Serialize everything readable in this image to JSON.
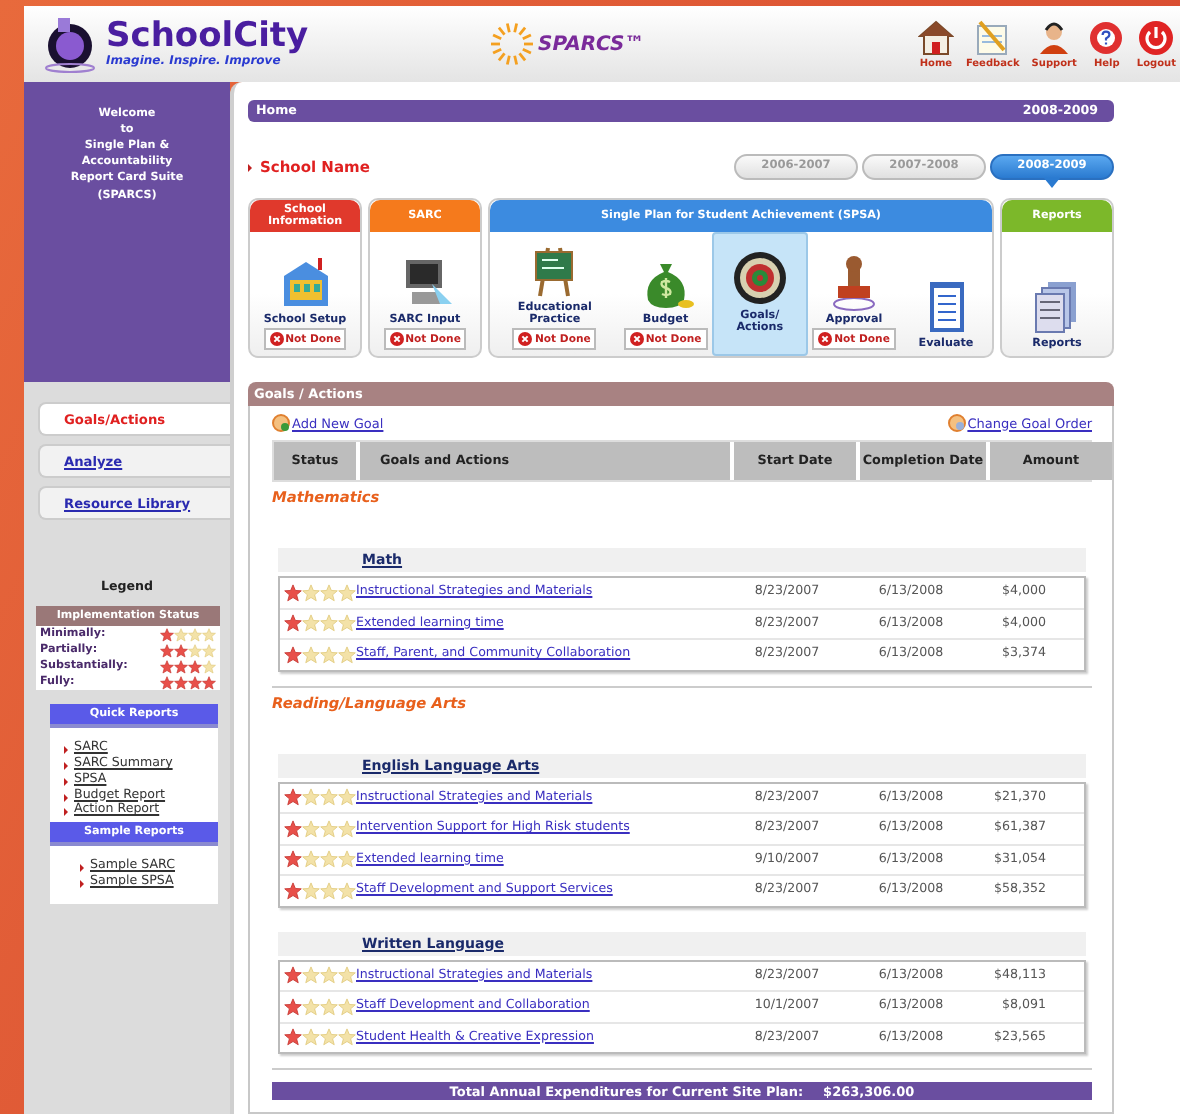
{
  "header": {
    "logo": {
      "name": "SchoolCity",
      "tagline": "Imagine. Inspire. Improve"
    },
    "product": "SPARCS™",
    "links": [
      {
        "label": "Home",
        "kind": "home"
      },
      {
        "label": "Feedback",
        "kind": "feedback"
      },
      {
        "label": "Support",
        "kind": "support"
      },
      {
        "label": "Help",
        "kind": "help"
      },
      {
        "label": "Logout",
        "kind": "logout"
      }
    ]
  },
  "sidebar": {
    "welcome": "Welcome\nto\nSingle Plan &\nAccountability\nReport Card Suite\n(SPARCS)",
    "nav": [
      {
        "label": "Goals/Actions",
        "selected": true
      },
      {
        "label": "Analyze",
        "selected": false
      },
      {
        "label": "Resource Library",
        "selected": false
      }
    ],
    "legend": {
      "title": "Legend",
      "heading": "Implementation Status",
      "levels": [
        {
          "label": "Minimally:",
          "stars": 1
        },
        {
          "label": "Partially:",
          "stars": 2
        },
        {
          "label": "Substantially:",
          "stars": 3
        },
        {
          "label": "Fully:",
          "stars": 4
        }
      ]
    },
    "quick_reports": {
      "title": "Quick Reports",
      "links": [
        "SARC",
        "SARC Summary",
        "SPSA",
        "Budget Report",
        "Action Report"
      ]
    },
    "sample_reports": {
      "title": "Sample Reports",
      "links": [
        "Sample SARC",
        "Sample SPSA"
      ]
    }
  },
  "breadcrumb": {
    "label": "Home",
    "year": "2008-2009"
  },
  "school_name": "School Name",
  "years": [
    {
      "label": "2006-2007",
      "selected": false
    },
    {
      "label": "2007-2008",
      "selected": false
    },
    {
      "label": "2008-2009",
      "selected": true
    }
  ],
  "modules": [
    {
      "title": "School Information",
      "color": "#e0392c",
      "items": [
        {
          "label": "School Setup",
          "kind": "building",
          "status": "Not Done",
          "selected": false
        }
      ]
    },
    {
      "title": "SARC",
      "color": "#f57a1c",
      "items": [
        {
          "label": "SARC Input",
          "kind": "computer",
          "status": "Not Done",
          "selected": false
        }
      ]
    },
    {
      "title": "Single Plan for Student Achievement (SPSA)",
      "color": "#3c8be0",
      "items": [
        {
          "label": "Educational Practice",
          "kind": "easel",
          "status": "Not Done",
          "selected": false
        },
        {
          "label": "Budget",
          "kind": "money",
          "status": "Not Done",
          "selected": false
        },
        {
          "label": "Goals/ Actions",
          "kind": "dartboard",
          "selected": true
        },
        {
          "label": "Approval",
          "kind": "stamp",
          "status": "Not Done",
          "selected": false
        },
        {
          "label": "Evaluate",
          "kind": "clipboard",
          "selected": false
        }
      ]
    },
    {
      "title": "Reports",
      "color": "#7cb82a",
      "items": [
        {
          "label": "Reports",
          "kind": "reports",
          "selected": false
        }
      ]
    }
  ],
  "goals_panel": {
    "title": "Goals / Actions",
    "add_link": "Add New Goal",
    "order_link": "Change Goal Order",
    "columns": [
      "Status",
      "Goals and Actions",
      "Start Date",
      "Completion Date",
      "Amount"
    ],
    "areas": [
      {
        "name": "Mathematics",
        "goals": [
          {
            "name": "Math",
            "actions": [
              {
                "stars": 1,
                "title": "Instructional Strategies and Materials",
                "start": "8/23/2007",
                "end": "6/13/2008",
                "amount": "$4,000"
              },
              {
                "stars": 1,
                "title": "Extended learning time",
                "start": "8/23/2007",
                "end": "6/13/2008",
                "amount": "$4,000"
              },
              {
                "stars": 1,
                "title": "Staff, Parent, and Community Collaboration",
                "start": "8/23/2007",
                "end": "6/13/2008",
                "amount": "$3,374"
              }
            ]
          }
        ]
      },
      {
        "name": "Reading/Language Arts",
        "goals": [
          {
            "name": "English Language Arts",
            "actions": [
              {
                "stars": 1,
                "title": "Instructional Strategies and Materials",
                "start": "8/23/2007",
                "end": "6/13/2008",
                "amount": "$21,370"
              },
              {
                "stars": 1,
                "title": "Intervention Support for High Risk students",
                "start": "8/23/2007",
                "end": "6/13/2008",
                "amount": "$61,387"
              },
              {
                "stars": 1,
                "title": "Extended learning time",
                "start": "9/10/2007",
                "end": "6/13/2008",
                "amount": "$31,054"
              },
              {
                "stars": 1,
                "title": "Staff Development and Support Services",
                "start": "8/23/2007",
                "end": "6/13/2008",
                "amount": "$58,352"
              }
            ]
          },
          {
            "name": "Written Language",
            "actions": [
              {
                "stars": 1,
                "title": "Instructional Strategies and Materials",
                "start": "8/23/2007",
                "end": "6/13/2008",
                "amount": "$48,113"
              },
              {
                "stars": 1,
                "title": "Staff Development and Collaboration",
                "start": "10/1/2007",
                "end": "6/13/2008",
                "amount": "$8,091"
              },
              {
                "stars": 1,
                "title": "Student Health & Creative Expression",
                "start": "8/23/2007",
                "end": "6/13/2008",
                "amount": "$23,565"
              }
            ]
          }
        ]
      }
    ],
    "total": {
      "label": "Total Annual Expenditures for Current Site Plan:",
      "amount": "$263,306.00"
    }
  }
}
